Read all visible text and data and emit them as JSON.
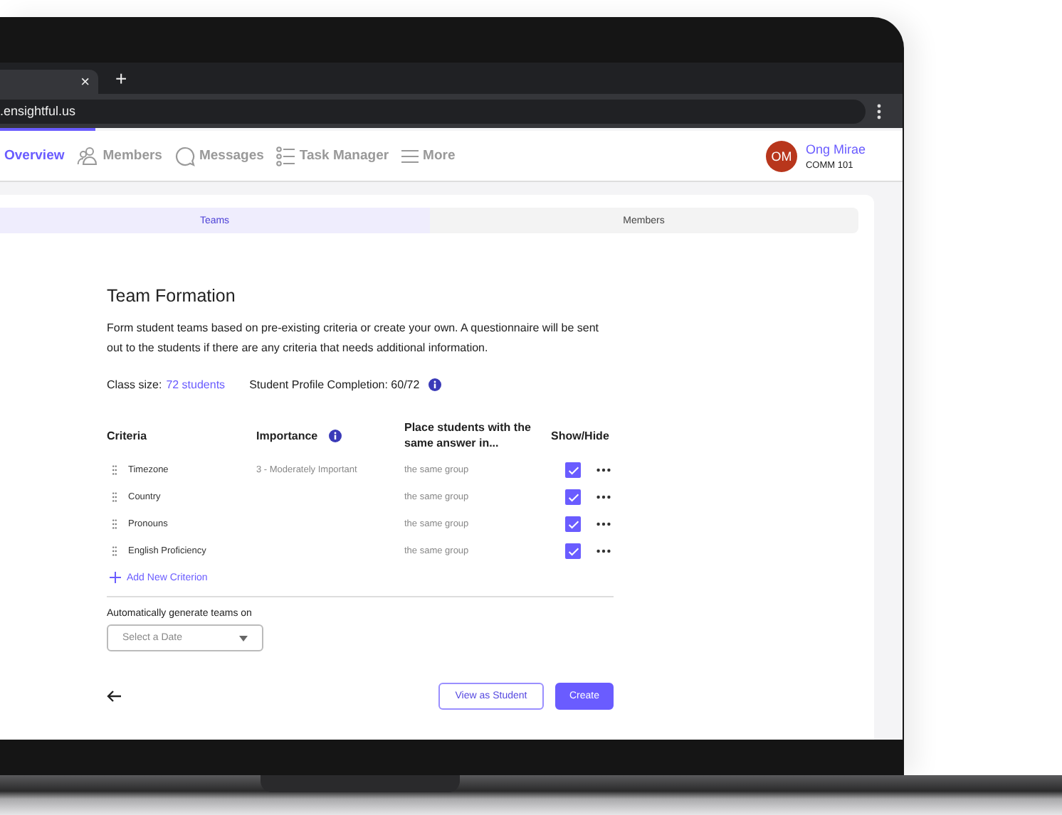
{
  "browser": {
    "tab_close": "×",
    "new_tab": "+",
    "url": ".ensightful.us"
  },
  "nav": {
    "items": [
      {
        "label": "Overview",
        "selected": true,
        "kind": "plain"
      },
      {
        "label": "Members",
        "selected": false,
        "kind": "people"
      },
      {
        "label": "Messages",
        "selected": false,
        "kind": "bubble"
      },
      {
        "label": "Task Manager",
        "selected": false,
        "kind": "list"
      },
      {
        "label": "More",
        "selected": false,
        "kind": "lines"
      }
    ],
    "user": {
      "initials": "OM",
      "name": "Ong Mirae",
      "course": "COMM 101"
    }
  },
  "segments": [
    {
      "label": "Teams",
      "selected": true
    },
    {
      "label": "Members",
      "selected": false
    }
  ],
  "title": "Team Formation",
  "description": "Form student teams based on pre-existing criteria or create your own. A questionnaire will be sent out to the students if there are any criteria that needs additional information.",
  "class_size": {
    "label": "Class size:",
    "link": "72 students"
  },
  "completion": "Student Profile Completion: 60/72",
  "table": {
    "columns": [
      "Criteria",
      "Importance",
      "Place students with the same answer in...",
      "Show/Hide"
    ],
    "rows": [
      {
        "criterion": "Timezone",
        "importance": "3 - Moderately Important",
        "placement": "the same group",
        "checked": true
      },
      {
        "criterion": "Country",
        "placement": "the same group",
        "checked": true
      },
      {
        "criterion": "Pronouns",
        "placement": "the same group",
        "checked": true
      },
      {
        "criterion": "English Proficiency",
        "placement": "the same group",
        "checked": true
      }
    ]
  },
  "add_criterion": "Add New Criterion",
  "schedule": {
    "label": "Automatically generate teams on",
    "placeholder": "Select a Date"
  },
  "buttons": [
    {
      "label": "View as Student",
      "kind": "secondary"
    },
    {
      "label": "Create",
      "kind": "primary"
    }
  ]
}
